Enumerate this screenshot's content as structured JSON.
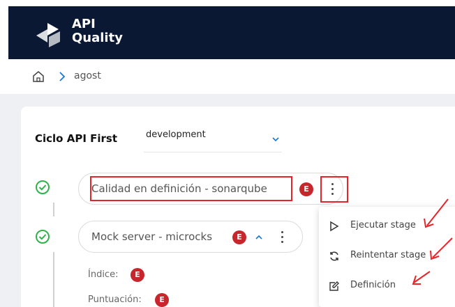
{
  "app": {
    "logo_line1": "API",
    "logo_line2": "Quality"
  },
  "breadcrumb": {
    "item": "agost"
  },
  "cycle": {
    "label": "Ciclo API First",
    "environment": "development"
  },
  "stages": [
    {
      "label": "Calidad en definición - sonarqube",
      "badge": "E",
      "status": "completed"
    },
    {
      "label": "Mock server - microcks",
      "badge": "E",
      "status": "completed"
    }
  ],
  "stage_details": {
    "index_label": "Índice:",
    "index_badge": "E",
    "score_label": "Puntuación:",
    "score_badge": "E"
  },
  "context_menu": {
    "items": [
      {
        "label": "Ejecutar stage",
        "icon": "play-icon"
      },
      {
        "label": "Reintentar stage",
        "icon": "refresh-icon"
      },
      {
        "label": "Definición",
        "icon": "edit-icon"
      }
    ]
  },
  "colors": {
    "header_bg": "#0b1834",
    "accent": "#1976d2",
    "success": "#2cb34a",
    "badge": "#c7262d",
    "highlight": "#e5252a"
  }
}
